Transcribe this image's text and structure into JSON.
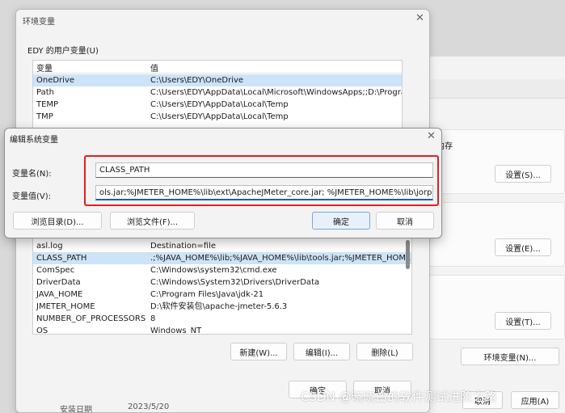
{
  "env_window": {
    "title": "环境变量",
    "user_group_label": "EDY 的用户变量(U)",
    "user_vars": {
      "col_name": "变量",
      "col_value": "值",
      "rows": [
        {
          "name": "OneDrive",
          "value": "C:\\Users\\EDY\\OneDrive"
        },
        {
          "name": "Path",
          "value": "C:\\Users\\EDY\\AppData\\Local\\Microsoft\\WindowsApps;;D:\\Progra..."
        },
        {
          "name": "TEMP",
          "value": "C:\\Users\\EDY\\AppData\\Local\\Temp"
        },
        {
          "name": "TMP",
          "value": "C:\\Users\\EDY\\AppData\\Local\\Temp"
        }
      ]
    },
    "system_vars": {
      "rows": [
        {
          "name": "asl.log",
          "value": "Destination=file"
        },
        {
          "name": "CLASS_PATH",
          "value": ".;%JAVA_HOME%\\lib;%JAVA_HOME%\\lib\\tools.jar;%JMETER_HOM..."
        },
        {
          "name": "ComSpec",
          "value": "C:\\Windows\\system32\\cmd.exe"
        },
        {
          "name": "DriverData",
          "value": "C:\\Windows\\System32\\Drivers\\DriverData"
        },
        {
          "name": "JAVA_HOME",
          "value": "C:\\Program Files\\Java\\jdk-21"
        },
        {
          "name": "JMETER_HOME",
          "value": "D:\\软件安装包\\apache-jmeter-5.6.3"
        },
        {
          "name": "NUMBER_OF_PROCESSORS",
          "value": "8"
        },
        {
          "name": "OS",
          "value": "Windows_NT"
        }
      ],
      "new_label": "新建(W)...",
      "edit_label": "编辑(I)...",
      "delete_label": "删除(L)"
    },
    "ok_label": "确定",
    "cancel_label": "取消",
    "bottom_partial_name": "安装日期",
    "bottom_partial_value": "2023/5/20"
  },
  "edit_dialog": {
    "title": "编辑系统变量",
    "name_label": "变量名(N):",
    "value_label": "变量值(V):",
    "name_value": "CLASS_PATH",
    "value_value": "ols.jar;%JMETER_HOME%\\lib\\ext\\ApacheJMeter_core.jar; %JMETER_HOME%\\lib\\jorphan.jar;",
    "browse_dir_label": "浏览目录(D)...",
    "browse_file_label": "浏览文件(F)...",
    "ok_label": "确定",
    "cancel_label": "取消"
  },
  "sys_props": {
    "text_partial": "内存",
    "settings_s": "设置(S)...",
    "settings_e": "设置(E)...",
    "settings_t": "设置(T)...",
    "env_vars_button": "环境变量(N)...",
    "partial_cancel": "取消",
    "partial_apply": "应用(A)"
  },
  "watermark": "CSDN @晓晓白的软件测试进阶之路",
  "colors": {
    "highlight_red": "#e02020",
    "selection_blue": "#cde3f7",
    "focus_blue": "#1a5fb4"
  }
}
